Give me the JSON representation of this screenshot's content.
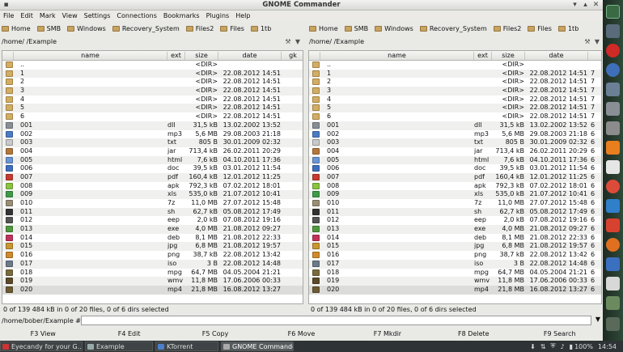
{
  "window": {
    "title": "GNOME Commander"
  },
  "menu": [
    "File",
    "Edit",
    "Mark",
    "View",
    "Settings",
    "Connections",
    "Bookmarks",
    "Plugins",
    "Help"
  ],
  "bookmarks": [
    "Home",
    "SMB",
    "Windows",
    "Recovery_System",
    "Files2",
    "Files",
    "1tb"
  ],
  "left": {
    "path": "/home/      /Example",
    "columns": [
      "name",
      "ext",
      "size",
      "date",
      "gk"
    ]
  },
  "right": {
    "path": "/home/      /Example",
    "columns": [
      "name",
      "ext",
      "size",
      "date"
    ]
  },
  "files": [
    {
      "name": "..",
      "ext": "",
      "size": "<DIR>",
      "date": "",
      "perm": "",
      "type": "folder",
      "color": "#d1ad66"
    },
    {
      "name": "1",
      "ext": "",
      "size": "<DIR>",
      "date": "22.08.2012 14:51",
      "perm": "7",
      "type": "folder",
      "color": "#d1ad66"
    },
    {
      "name": "2",
      "ext": "",
      "size": "<DIR>",
      "date": "22.08.2012 14:51",
      "perm": "7",
      "type": "folder",
      "color": "#d1ad66"
    },
    {
      "name": "3",
      "ext": "",
      "size": "<DIR>",
      "date": "22.08.2012 14:51",
      "perm": "7",
      "type": "folder",
      "color": "#d1ad66"
    },
    {
      "name": "4",
      "ext": "",
      "size": "<DIR>",
      "date": "22.08.2012 14:51",
      "perm": "7",
      "type": "folder",
      "color": "#d1ad66"
    },
    {
      "name": "5",
      "ext": "",
      "size": "<DIR>",
      "date": "22.08.2012 14:51",
      "perm": "7",
      "type": "folder",
      "color": "#d1ad66"
    },
    {
      "name": "6",
      "ext": "",
      "size": "<DIR>",
      "date": "22.08.2012 14:51",
      "perm": "7",
      "type": "folder",
      "color": "#d1ad66"
    },
    {
      "name": "001",
      "ext": "dll",
      "size": "31,5 kB",
      "date": "13.02.2002 13:52",
      "perm": "6",
      "type": "file",
      "color": "#8a8f96"
    },
    {
      "name": "002",
      "ext": "mp3",
      "size": "5,6 MB",
      "date": "29.08.2003 21:18",
      "perm": "6",
      "type": "file",
      "color": "#4a7bc4"
    },
    {
      "name": "003",
      "ext": "txt",
      "size": "805 B",
      "date": "30.01.2009 02:32",
      "perm": "6",
      "type": "file",
      "color": "#c9c9c9"
    },
    {
      "name": "004",
      "ext": "jar",
      "size": "713,4 kB",
      "date": "26.02.2011 20:29",
      "perm": "6",
      "type": "file",
      "color": "#b5763b"
    },
    {
      "name": "005",
      "ext": "html",
      "size": "7,6 kB",
      "date": "04.10.2011 17:36",
      "perm": "6",
      "type": "file",
      "color": "#6a95d6"
    },
    {
      "name": "006",
      "ext": "doc",
      "size": "39,5 kB",
      "date": "03.01.2012 11:54",
      "perm": "6",
      "type": "file",
      "color": "#3e6fbf"
    },
    {
      "name": "007",
      "ext": "pdf",
      "size": "160,4 kB",
      "date": "12.01.2012 11:25",
      "perm": "6",
      "type": "file",
      "color": "#c83a2e"
    },
    {
      "name": "008",
      "ext": "apk",
      "size": "792,3 kB",
      "date": "07.02.2012 18:01",
      "perm": "6",
      "type": "file",
      "color": "#8ac43f"
    },
    {
      "name": "009",
      "ext": "xls",
      "size": "535,0 kB",
      "date": "21.07.2012 10:41",
      "perm": "6",
      "type": "file",
      "color": "#3e9a47"
    },
    {
      "name": "010",
      "ext": "7z",
      "size": "11,0 MB",
      "date": "27.07.2012 15:48",
      "perm": "6",
      "type": "file",
      "color": "#9a8f76"
    },
    {
      "name": "011",
      "ext": "sh",
      "size": "62,7 kB",
      "date": "05.08.2012 17:49",
      "perm": "6",
      "type": "file",
      "color": "#333333"
    },
    {
      "name": "012",
      "ext": "eep",
      "size": "2,0 kB",
      "date": "07.08.2012 19:16",
      "perm": "6",
      "type": "file",
      "color": "#555555"
    },
    {
      "name": "013",
      "ext": "exe",
      "size": "4,0 MB",
      "date": "21.08.2012 09:27",
      "perm": "6",
      "type": "file",
      "color": "#4f9a3e"
    },
    {
      "name": "014",
      "ext": "deb",
      "size": "8,1 MB",
      "date": "21.08.2012 22:33",
      "perm": "6",
      "type": "file",
      "color": "#c2335b"
    },
    {
      "name": "015",
      "ext": "jpg",
      "size": "6,8 MB",
      "date": "21.08.2012 19:57",
      "perm": "6",
      "type": "file",
      "color": "#c9962f"
    },
    {
      "name": "016",
      "ext": "png",
      "size": "38,7 kB",
      "date": "22.08.2012 13:42",
      "perm": "6",
      "type": "file",
      "color": "#d08a2a"
    },
    {
      "name": "017",
      "ext": "iso",
      "size": "3 B",
      "date": "22.08.2012 14:48",
      "perm": "6",
      "type": "file",
      "color": "#6c7a8a"
    },
    {
      "name": "018",
      "ext": "mpg",
      "size": "64,7 MB",
      "date": "04.05.2004 21:21",
      "perm": "6",
      "type": "file",
      "color": "#7a6a3c"
    },
    {
      "name": "019",
      "ext": "wmv",
      "size": "11,8 MB",
      "date": "17.06.2006 00:33",
      "perm": "6",
      "type": "file",
      "color": "#5b4a2a"
    },
    {
      "name": "020",
      "ext": "mp4",
      "size": "21,8 MB",
      "date": "16.08.2012 13:27",
      "perm": "6",
      "type": "file",
      "color": "#6b5a32"
    }
  ],
  "status": {
    "left": "0  of 139 484  kB in 0 of 20 files, 0 of 6 dirs selected",
    "right": "0  of 139 484  kB in 0 of 20 files, 0 of 6 dirs selected"
  },
  "cmdline": {
    "label": "/home/bober/Example #"
  },
  "fkeys": [
    "F3 View",
    "F4 Edit",
    "F5 Copy",
    "F6 Move",
    "F7 Mkdir",
    "F8 Delete",
    "F9 Search"
  ],
  "taskbar": {
    "tasks": [
      "Eyecandy for your G...",
      "Example",
      "KTorrent",
      "GNOME Commander"
    ],
    "battery": "100%",
    "clock": "14:54"
  },
  "colors": {
    "titlebar": "#d9d9d6",
    "selection": "#dcdcda",
    "folder": "#d1ad66",
    "taskbar": "#2e3436"
  }
}
